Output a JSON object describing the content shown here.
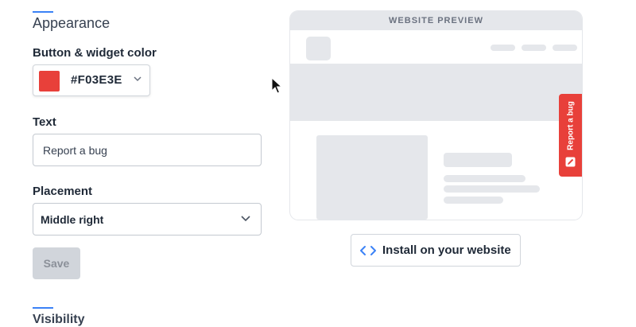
{
  "appearance": {
    "title": "Appearance",
    "color_label": "Button & widget color",
    "color_value": "#F03E3E",
    "swatch_color": "#e8403a",
    "text_label": "Text",
    "text_value": "Report a bug",
    "placement_label": "Placement",
    "placement_value": "Middle right",
    "save_label": "Save",
    "next_section_title": "Visibility"
  },
  "preview": {
    "header": "WEBSITE PREVIEW",
    "feedback_tab_text": "Report a bug",
    "feedback_tab_icon": "pencil-icon",
    "install_label": "Install on your website",
    "install_icon": "code-icon"
  },
  "colors": {
    "accent": "#3b82f6",
    "widget": "#e8403a"
  }
}
